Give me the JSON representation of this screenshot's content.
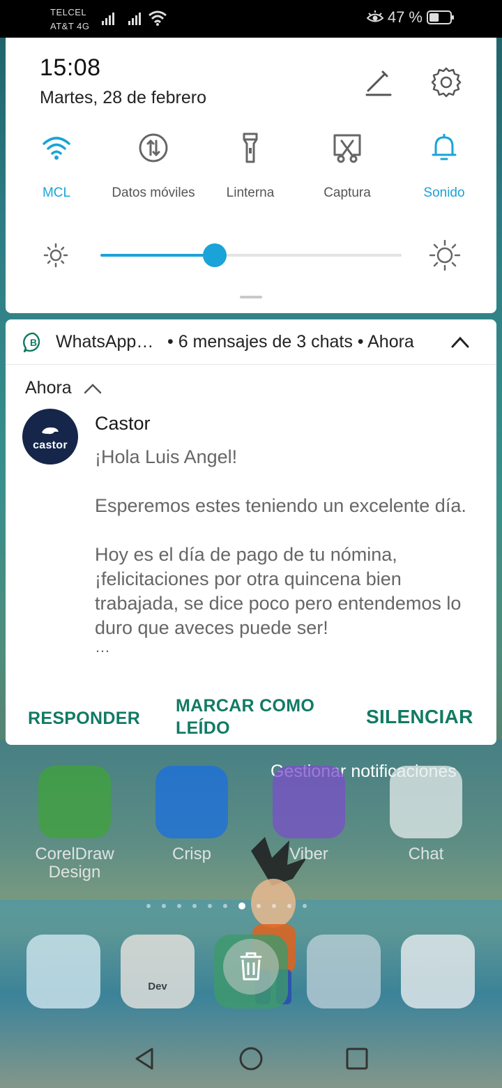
{
  "status_bar": {
    "carrier_1": "TELCEL",
    "carrier_2": "AT&T 4G",
    "battery_percent": "47 %",
    "battery_level": 0.47,
    "icons": [
      "signal-icon",
      "signal-icon",
      "wifi-icon",
      "eye-comfort-icon",
      "battery-icon"
    ]
  },
  "quick_settings": {
    "time": "15:08",
    "date": "Martes, 28 de febrero",
    "tiles": [
      {
        "label": "MCL",
        "icon": "wifi-icon",
        "active": true
      },
      {
        "label": "Datos móviles",
        "icon": "mobile-data-icon",
        "active": false
      },
      {
        "label": "Linterna",
        "icon": "flashlight-icon",
        "active": false
      },
      {
        "label": "Captura",
        "icon": "screenshot-icon",
        "active": false
      },
      {
        "label": "Sonido",
        "icon": "bell-icon",
        "active": true
      }
    ],
    "brightness_level": 0.38,
    "accent_color": "#1aa3d8"
  },
  "notification": {
    "app_name": "WhatsApp…",
    "summary": "• 6 mensajes de 3 chats • Ahora",
    "group_time": "Ahora",
    "sender": "Castor",
    "avatar_text": "castor",
    "message": [
      "¡Hola Luis Angel!",
      "Esperemos estes teniendo un excelente día.",
      "Hoy es el día de pago de tu nómina, ¡felicitaciones por otra quincena bien trabajada, se dice poco pero entendemos lo duro que aveces puede ser!",
      "…"
    ],
    "actions": {
      "reply": "RESPONDER",
      "mark_read": "MARCAR COMO LEÍDO",
      "mute": "SILENCIAR"
    },
    "action_color": "#127a64"
  },
  "manage_notifications": "Gestionar notificaciones",
  "home_apps": [
    {
      "name": "CorelDraw Design",
      "color": "#3fa33a"
    },
    {
      "name": "Crisp",
      "color": "#1a6fe0"
    },
    {
      "name": "Viber",
      "color": "#7a4fc8"
    },
    {
      "name": "Chat",
      "color": "#e6ecec"
    }
  ],
  "page_indicator": {
    "count": 11,
    "active": 6
  },
  "dock_apps": [
    {
      "name": "camera-app-icon",
      "color": "#cfe6ef"
    },
    {
      "name": "chrome-dev-icon",
      "color": "#e8e4df"
    },
    {
      "name": "messages-icon",
      "color": "#3d9a6c"
    },
    {
      "name": "folder-icon",
      "color": "#b9cdd6"
    },
    {
      "name": "contacts-icon",
      "color": "#e8ecef"
    }
  ],
  "chrome_dev_label": "Dev"
}
